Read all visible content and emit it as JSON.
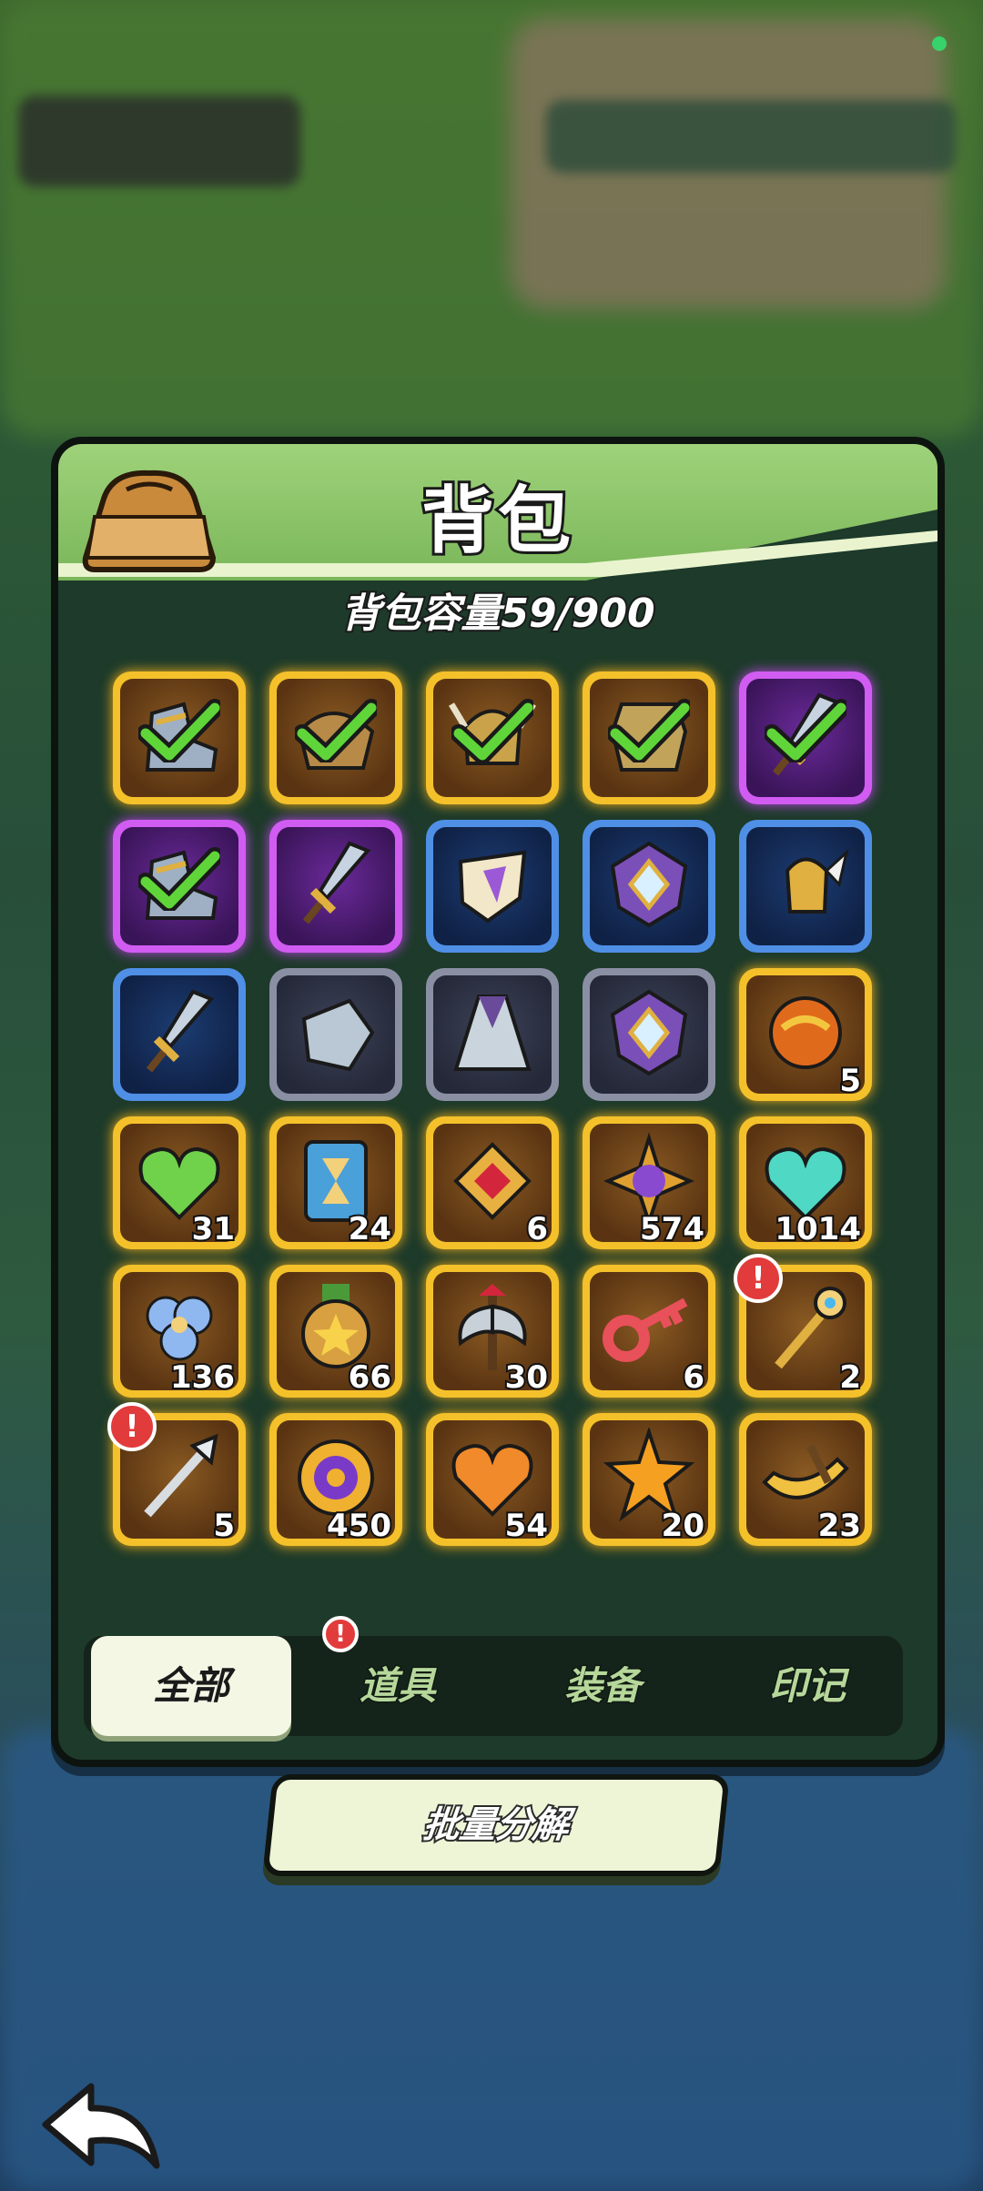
{
  "backpack": {
    "title": "背包",
    "capacity_text": "背包容量59/900"
  },
  "items": [
    {
      "rarity": "gold",
      "icon": "boots-icon",
      "selected": true
    },
    {
      "rarity": "gold",
      "icon": "shoulder-armor-icon",
      "selected": true
    },
    {
      "rarity": "gold",
      "icon": "horned-helmet-icon",
      "selected": true
    },
    {
      "rarity": "gold",
      "icon": "chest-armor-icon",
      "selected": true
    },
    {
      "rarity": "purple",
      "icon": "sword-icon",
      "selected": true
    },
    {
      "rarity": "purple",
      "icon": "boots-icon",
      "selected": true
    },
    {
      "rarity": "purple",
      "icon": "sword-icon",
      "selected": false
    },
    {
      "rarity": "blue",
      "icon": "shield-icon",
      "selected": false
    },
    {
      "rarity": "blue",
      "icon": "gem-shield-icon",
      "selected": false
    },
    {
      "rarity": "blue",
      "icon": "winged-helmet-icon",
      "selected": false
    },
    {
      "rarity": "blue",
      "icon": "sword-icon",
      "selected": false
    },
    {
      "rarity": "gray",
      "icon": "gauntlet-icon",
      "selected": false
    },
    {
      "rarity": "gray",
      "icon": "robe-icon",
      "selected": false
    },
    {
      "rarity": "gray",
      "icon": "gem-shield-icon",
      "selected": false
    },
    {
      "rarity": "gold",
      "icon": "orb-icon",
      "count": "5"
    },
    {
      "rarity": "gold",
      "icon": "green-heart-icon",
      "count": "31"
    },
    {
      "rarity": "gold",
      "icon": "hourglass-card-icon",
      "count": "24"
    },
    {
      "rarity": "gold",
      "icon": "ruby-badge-icon",
      "count": "6"
    },
    {
      "rarity": "gold",
      "icon": "crown-medal-icon",
      "count": "574"
    },
    {
      "rarity": "gold",
      "icon": "teal-heart-icon",
      "count": "1014"
    },
    {
      "rarity": "gold",
      "icon": "blue-flower-icon",
      "count": "136"
    },
    {
      "rarity": "gold",
      "icon": "star-medal-icon",
      "count": "66"
    },
    {
      "rarity": "gold",
      "icon": "axe-icon",
      "count": "30"
    },
    {
      "rarity": "gold",
      "icon": "red-key-icon",
      "count": "6"
    },
    {
      "rarity": "gold",
      "icon": "gold-scepter-icon",
      "count": "2",
      "alert": true
    },
    {
      "rarity": "gold",
      "icon": "silver-scepter-icon",
      "count": "5",
      "alert": true
    },
    {
      "rarity": "gold",
      "icon": "purple-coin-icon",
      "count": "450"
    },
    {
      "rarity": "gold",
      "icon": "orange-heart-icon",
      "count": "54"
    },
    {
      "rarity": "gold",
      "icon": "orange-star-icon",
      "count": "20"
    },
    {
      "rarity": "gold",
      "icon": "gold-horn-icon",
      "count": "23"
    }
  ],
  "tabs": [
    {
      "label": "全部",
      "active": true
    },
    {
      "label": "道具",
      "active": false,
      "alert": true
    },
    {
      "label": "装备",
      "active": false
    },
    {
      "label": "印记",
      "active": false
    }
  ],
  "alert_mark": "!",
  "batch_button": "批量分解",
  "colors": {
    "gold_border": "#f4c12b",
    "purple_border": "#d15cf2",
    "blue_border": "#4f8fe6",
    "gray_border": "#8b8fa3",
    "check_green": "#5fd53a",
    "alert_red": "#e23b3b"
  }
}
